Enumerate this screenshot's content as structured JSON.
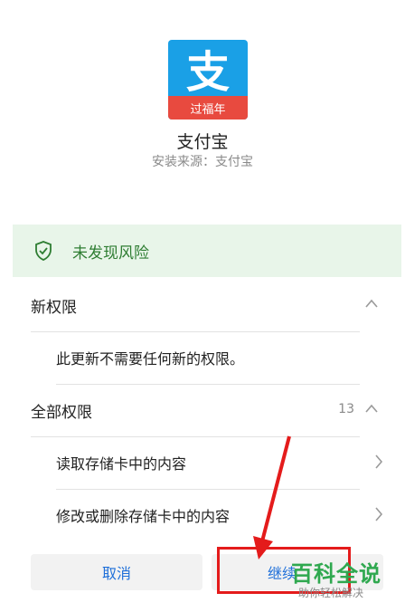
{
  "app": {
    "icon_glyph": "支",
    "icon_ribbon": "过福年",
    "name": "支付宝",
    "source": "安装来源：支付宝"
  },
  "risk": {
    "text": "未发现风险"
  },
  "new_permissions": {
    "label": "新权限",
    "item": "此更新不需要任何新的权限。"
  },
  "all_permissions": {
    "label": "全部权限",
    "count": "13",
    "items": [
      "读取存储卡中的内容",
      "修改或删除存储卡中的内容"
    ]
  },
  "buttons": {
    "cancel": "取消",
    "continue": "继续"
  },
  "watermark": {
    "title": "百科全说",
    "subtitle": "助你轻松解决"
  },
  "colors": {
    "accent": "#1e6fd9",
    "safe_green": "#2e7d32",
    "safe_bg": "#e8f5e9",
    "alipay_blue": "#1aa0e6",
    "highlight_red": "#e41b1b"
  }
}
